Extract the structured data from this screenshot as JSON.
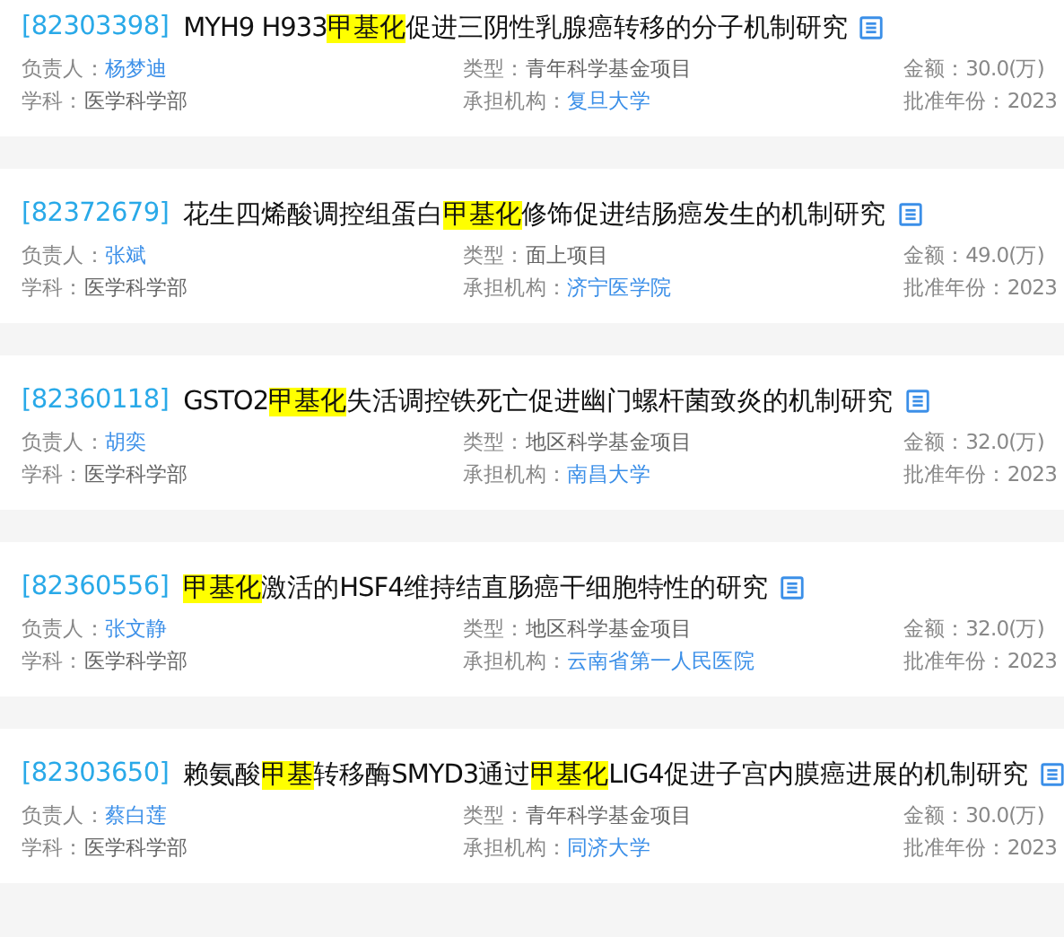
{
  "projects": [
    {
      "id": "[82303398]",
      "title": [
        {
          "text": "MYH9 H933",
          "highlight": false
        },
        {
          "text": "甲基化",
          "highlight": true
        },
        {
          "text": "促进三阴性乳腺癌转移的分子机制研究",
          "highlight": false
        }
      ],
      "leader_label": "负责人：",
      "leader": "杨梦迪",
      "type_label": "类型：",
      "type": "青年科学基金项目",
      "amount": "金额：30.0(万)",
      "subject_label": "学科：",
      "subject": "医学科学部",
      "org_label": "承担机构：",
      "org": "复旦大学",
      "year": "批准年份：2023"
    },
    {
      "id": "[82372679]",
      "title": [
        {
          "text": "花生四烯酸调控组蛋白",
          "highlight": false
        },
        {
          "text": "甲基化",
          "highlight": true
        },
        {
          "text": "修饰促进结肠癌发生的机制研究",
          "highlight": false
        }
      ],
      "leader_label": "负责人：",
      "leader": "张斌",
      "type_label": "类型：",
      "type": "面上项目",
      "amount": "金额：49.0(万)",
      "subject_label": "学科：",
      "subject": "医学科学部",
      "org_label": "承担机构：",
      "org": "济宁医学院",
      "year": "批准年份：2023"
    },
    {
      "id": "[82360118]",
      "title": [
        {
          "text": "GSTO2",
          "highlight": false
        },
        {
          "text": "甲基化",
          "highlight": true
        },
        {
          "text": "失活调控铁死亡促进幽门螺杆菌致炎的机制研究",
          "highlight": false
        }
      ],
      "leader_label": "负责人：",
      "leader": "胡奕",
      "type_label": "类型：",
      "type": "地区科学基金项目",
      "amount": "金额：32.0(万)",
      "subject_label": "学科：",
      "subject": "医学科学部",
      "org_label": "承担机构：",
      "org": "南昌大学",
      "year": "批准年份：2023"
    },
    {
      "id": "[82360556]",
      "title": [
        {
          "text": "甲基化",
          "highlight": true
        },
        {
          "text": "激活的HSF4维持结直肠癌干细胞特性的研究",
          "highlight": false
        }
      ],
      "leader_label": "负责人：",
      "leader": "张文静",
      "type_label": "类型：",
      "type": "地区科学基金项目",
      "amount": "金额：32.0(万)",
      "subject_label": "学科：",
      "subject": "医学科学部",
      "org_label": "承担机构：",
      "org": "云南省第一人民医院",
      "year": "批准年份：2023"
    },
    {
      "id": "[82303650]",
      "title": [
        {
          "text": "赖氨酸",
          "highlight": false
        },
        {
          "text": "甲基",
          "highlight": true
        },
        {
          "text": "转移酶SMYD3通过",
          "highlight": false
        },
        {
          "text": "甲基化",
          "highlight": true
        },
        {
          "text": "LIG4促进子宫内膜癌进展的机制研究",
          "highlight": false
        }
      ],
      "leader_label": "负责人：",
      "leader": "蔡白莲",
      "type_label": "类型：",
      "type": "青年科学基金项目",
      "amount": "金额：30.0(万)",
      "subject_label": "学科：",
      "subject": "医学科学部",
      "org_label": "承担机构：",
      "org": "同济大学",
      "year": "批准年份：2023"
    }
  ]
}
